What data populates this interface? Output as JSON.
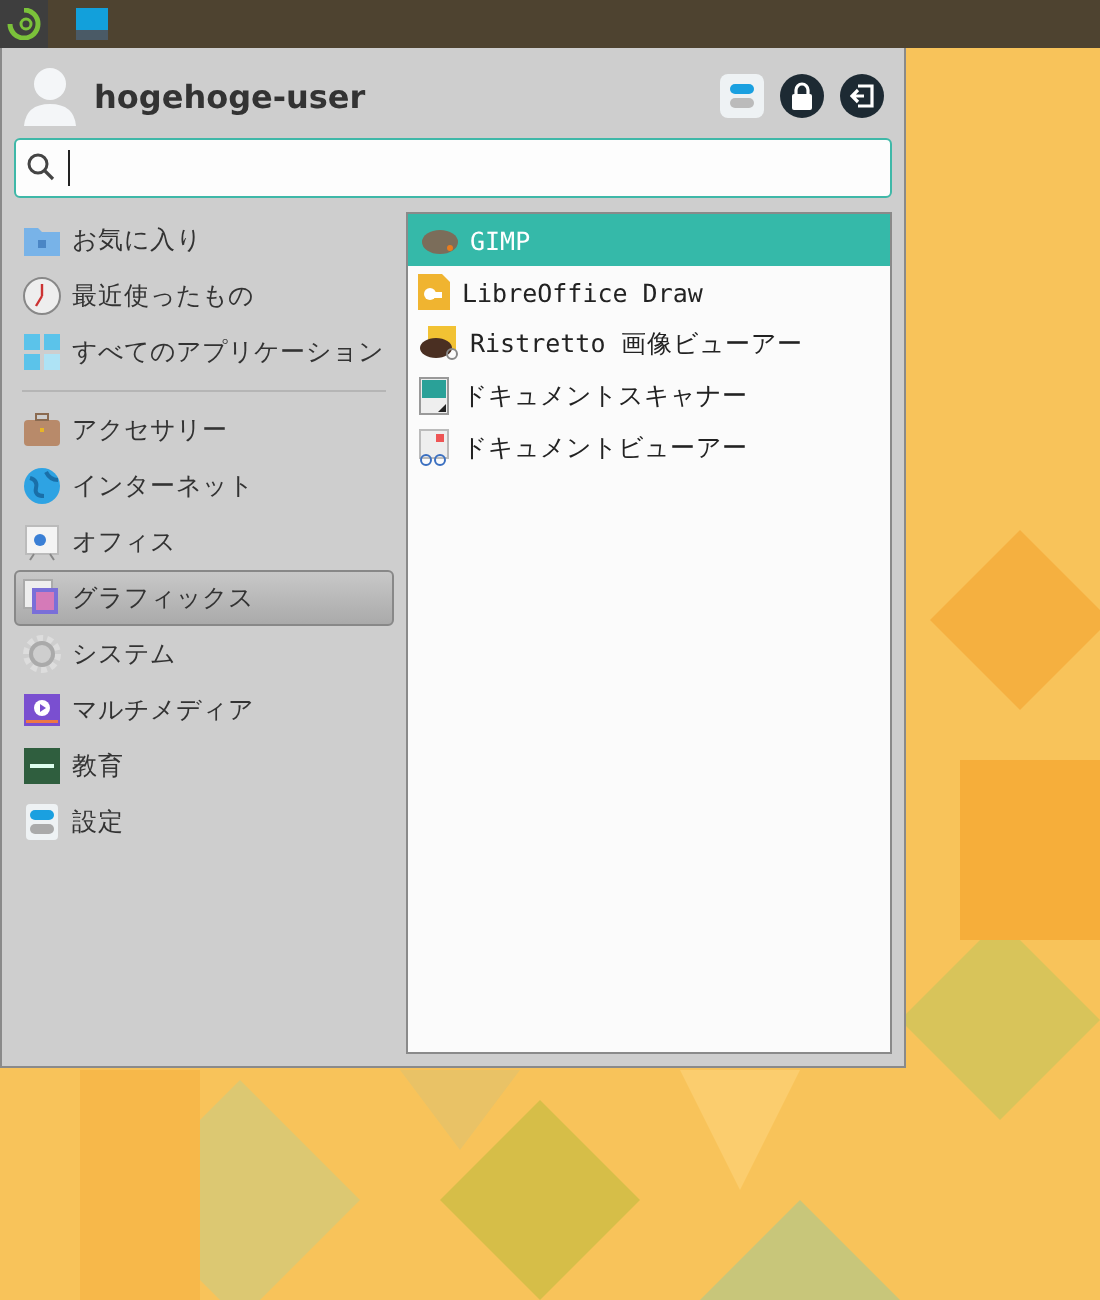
{
  "menu": {
    "user_name": "hogehoge-user",
    "category_groups": [
      {
        "items": [
          {
            "label": "お気に入り",
            "selected": false
          },
          {
            "label": "最近使ったもの",
            "selected": false
          },
          {
            "label": "すべてのアプリケーション",
            "selected": false
          }
        ]
      },
      {
        "items": [
          {
            "label": "アクセサリー",
            "selected": false
          },
          {
            "label": "インターネット",
            "selected": false
          },
          {
            "label": "オフィス",
            "selected": false
          },
          {
            "label": "グラフィックス",
            "selected": true
          },
          {
            "label": "システム",
            "selected": false
          },
          {
            "label": "マルチメディア",
            "selected": false
          },
          {
            "label": "教育",
            "selected": false
          },
          {
            "label": "設定",
            "selected": false
          }
        ]
      }
    ],
    "apps": [
      {
        "label": "GIMP",
        "selected": true
      },
      {
        "label": "LibreOffice Draw",
        "selected": false
      },
      {
        "label": "Ristretto 画像ビューアー",
        "selected": false
      },
      {
        "label": "ドキュメントスキャナー",
        "selected": false
      },
      {
        "label": "ドキュメントビューアー",
        "selected": false
      }
    ]
  }
}
